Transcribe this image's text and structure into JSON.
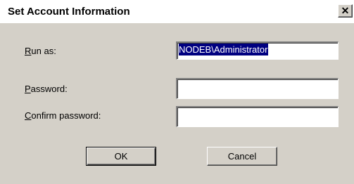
{
  "window": {
    "title": "Set Account Information",
    "close_glyph": "✕"
  },
  "form": {
    "run_as": {
      "label_mnemonic": "R",
      "label_rest": "un as:",
      "value": "NODEB\\Administrator"
    },
    "password": {
      "label_mnemonic": "P",
      "label_rest": "assword:",
      "value": ""
    },
    "confirm_password": {
      "label_mnemonic": "C",
      "label_rest": "onfirm password:",
      "value": ""
    }
  },
  "buttons": {
    "ok_label": "OK",
    "cancel_label": "Cancel"
  },
  "colors": {
    "face": "#d4d0c8",
    "selection": "#000080"
  }
}
